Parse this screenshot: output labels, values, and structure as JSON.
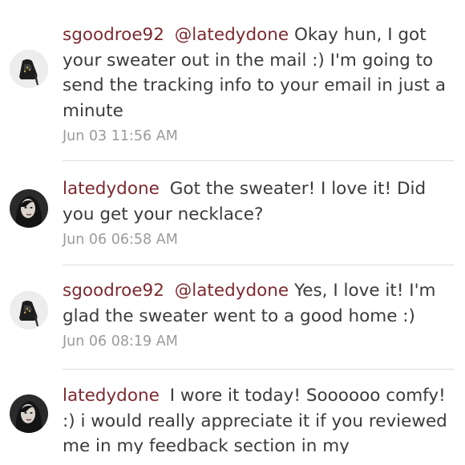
{
  "comments": [
    {
      "username": "sgoodroe92",
      "mention": "@latedydone",
      "body": "Okay hun, I got your sweater out in the mail :) I'm going to send the tracking info to your email in just a minute",
      "timestamp": "Jun 03 11:56 AM",
      "avatar_icon": "high-heel-shoe-avatar-icon"
    },
    {
      "username": "latedydone",
      "mention": "",
      "body": "Got the sweater! I love it! Did you get your necklace?",
      "timestamp": "Jun 06 06:58 AM",
      "avatar_icon": "woman-portrait-avatar-icon"
    },
    {
      "username": "sgoodroe92",
      "mention": "@latedydone",
      "body": "Yes, I love it! I'm glad the sweater went to a good home :)",
      "timestamp": "Jun 06 08:19 AM",
      "avatar_icon": "high-heel-shoe-avatar-icon"
    },
    {
      "username": "latedydone",
      "mention": "",
      "body": "I wore it today! Soooooo comfy! :) i would really appreciate it if you reviewed me in my feedback section in my",
      "timestamp": "",
      "avatar_icon": "woman-portrait-avatar-icon"
    }
  ],
  "colors": {
    "username": "#7c2a30",
    "body_text": "#3b3b3b",
    "timestamp": "#9a9a9a",
    "divider": "#dcdcdc"
  }
}
